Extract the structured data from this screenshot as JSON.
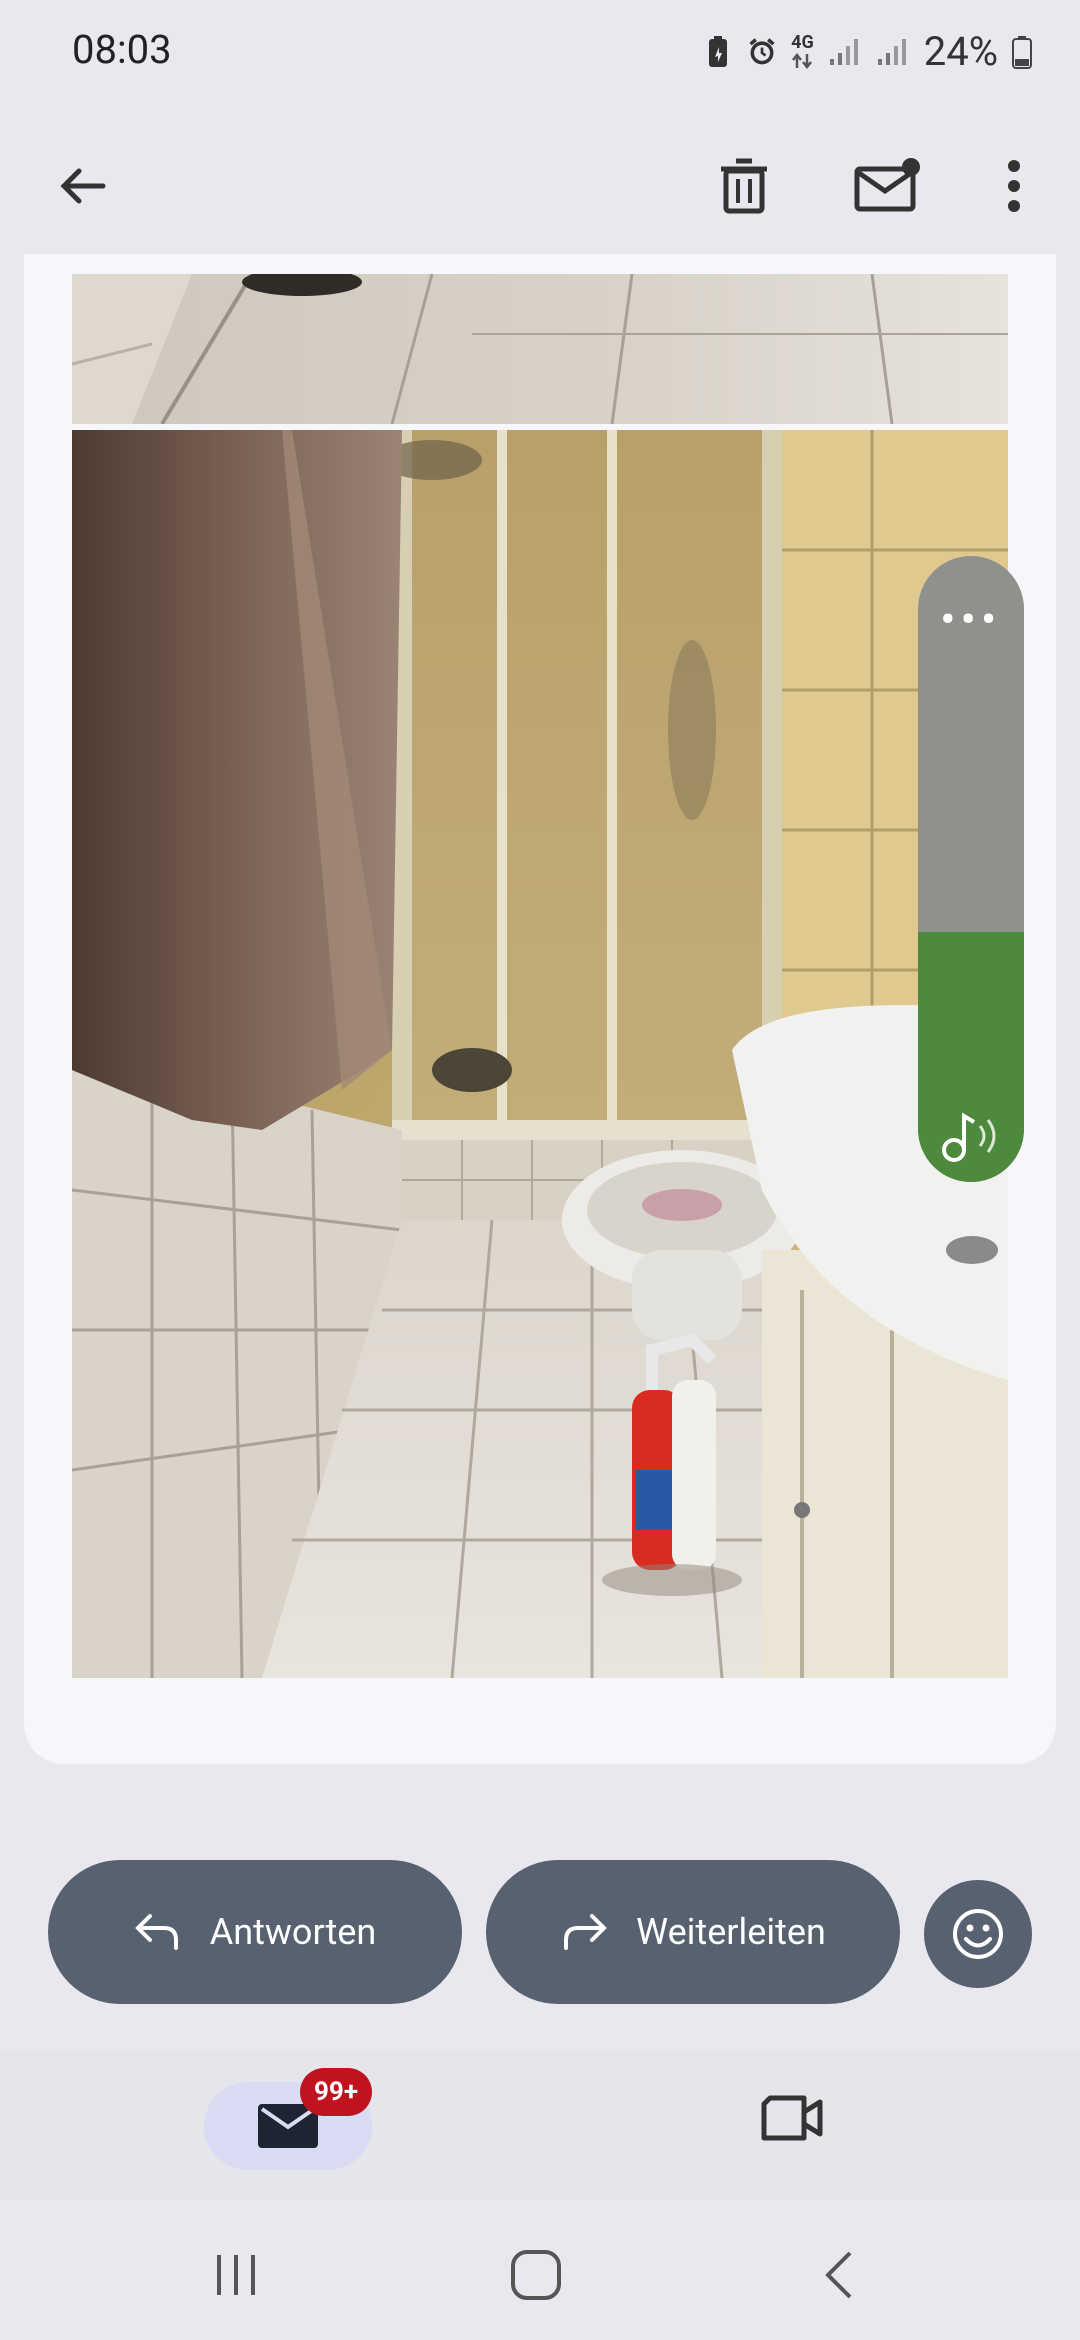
{
  "status_bar": {
    "time": "08:03",
    "battery_percent": "24%",
    "network": "4G",
    "icons": [
      "battery-saver-icon",
      "alarm-icon",
      "data-arrows-icon",
      "signal-icon",
      "signal-icon",
      "battery-icon"
    ]
  },
  "app_bar": {
    "icons": [
      "back-arrow-icon",
      "delete-icon",
      "mark-unread-icon",
      "more-vert-icon"
    ]
  },
  "attachments": [
    {
      "description": "bathroom floor tiles photo (cropped)"
    },
    {
      "description": "bathroom with shower, towel, toilet, sink and cleaning bottles"
    }
  ],
  "floating_tool": {
    "icons": [
      "more-horiz-icon",
      "music-note-icon"
    ],
    "level_fraction": 0.4
  },
  "actions": {
    "reply_label": "Antworten",
    "forward_label": "Weiterleiten",
    "reply_icon": "reply-icon",
    "forward_icon": "forward-icon",
    "emoji_icon": "emoji-icon"
  },
  "bottom_nav": {
    "mail_badge": "99+",
    "icons": [
      "mail-icon",
      "video-icon"
    ]
  },
  "colors": {
    "background": "#e8e8ee",
    "card": "#f6f6fb",
    "action_button": "#576170",
    "badge": "#c1121f",
    "mail_pill": "#d9dcf3",
    "pill_green": "#4e8a3e"
  }
}
